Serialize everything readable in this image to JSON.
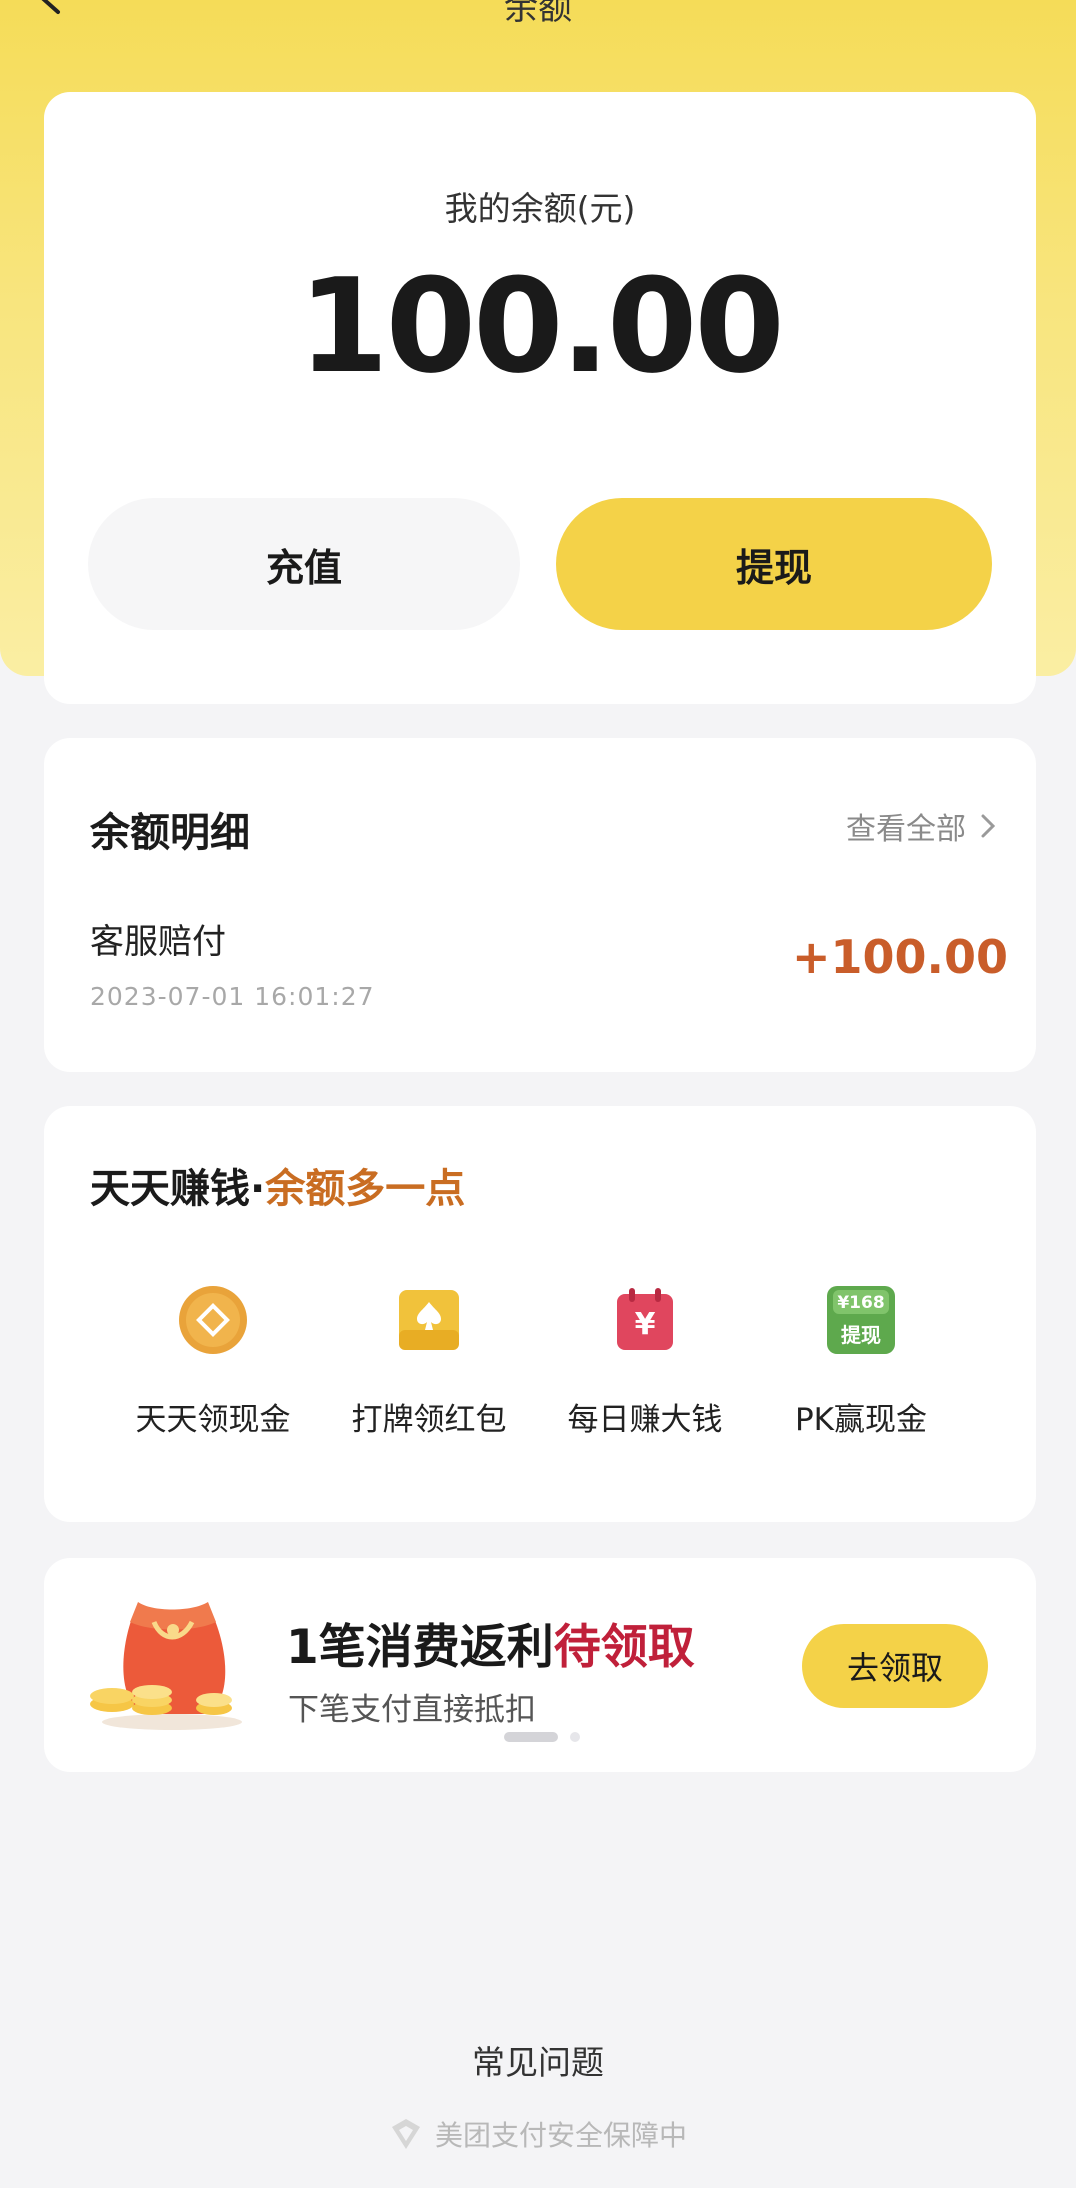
{
  "nav": {
    "title": "余额"
  },
  "balance": {
    "label": "我的余额(元)",
    "amount": "100.00",
    "recharge_label": "充值",
    "withdraw_label": "提现"
  },
  "details": {
    "title": "余额明细",
    "view_all": "查看全部",
    "transactions": [
      {
        "title": "客服赔付",
        "time": "2023-07-01 16:01:27",
        "amount": "+100.00"
      }
    ]
  },
  "earn": {
    "title": "天天赚钱·",
    "title_accent": "余额多一点",
    "items": [
      {
        "label": "天天领现金",
        "icon": "coin-icon"
      },
      {
        "label": "打牌领红包",
        "icon": "card-icon"
      },
      {
        "label": "每日赚大钱",
        "icon": "calendar-yuan-icon"
      },
      {
        "label": "PK赢现金",
        "icon": "withdraw-168-icon",
        "badge_top": "¥168",
        "badge_bottom": "提现"
      }
    ]
  },
  "promo": {
    "title": "1笔消费返利",
    "title_accent": "待领取",
    "subtitle": "下笔支付直接抵扣",
    "button": "去领取",
    "carousel_pages": 2,
    "active_page": 1
  },
  "footer": {
    "faq": "常见问题",
    "security": "美团支付安全保障中"
  },
  "colors": {
    "brand_yellow": "#f4d248",
    "amount_orange": "#c95d2a",
    "accent_orange": "#c96d22",
    "accent_red": "#c0203a"
  }
}
